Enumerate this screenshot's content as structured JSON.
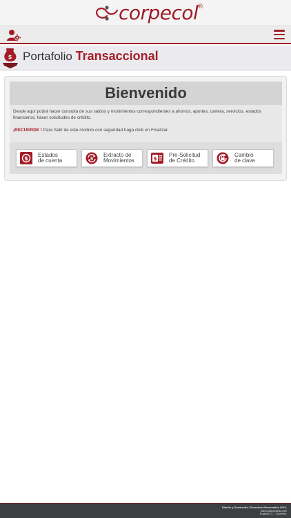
{
  "header": {
    "logo_text": "corpecol",
    "logo_reg": "®",
    "icons": {
      "logo": "corpecol-logo-icon",
      "user": "user-settings-icon",
      "menu": "menu-icon"
    }
  },
  "title": {
    "prefix": "Portafolio",
    "highlight": "Transaccional",
    "icon": "money-bag-icon"
  },
  "welcome": {
    "heading": "Bienvenido",
    "description": "Desde aquí podrá hacer consulta de sus saldos y movimientos correspondientes a ahorros, aportes, cartera, servicios, estados financieros, hacer solicitudes de crédito.",
    "recuerde_label": "¡RECUERDE !",
    "recuerde_text": " Para Salir de este modulo con seguridad haga click en Finalizar."
  },
  "buttons": [
    {
      "line1": "Estados",
      "line2": "de cuenta",
      "icon": "dollar-badge-icon"
    },
    {
      "line1": "Extracto de",
      "line2": "Movimientos",
      "icon": "dollar-refresh-icon"
    },
    {
      "line1": "Pre-Solicitud",
      "line2": "de Crédito",
      "icon": "credit-card-icon"
    },
    {
      "line1": "Cambio",
      "line2": "de clave",
      "icon": "lock-refresh-icon"
    }
  ],
  "footer": {
    "line1": "Diseño y Desarrollo / Derechos Reservados 2016.",
    "line2": "www.holacorpdesa.com",
    "line3": "Bogotá D.C. - Colombia."
  },
  "colors": {
    "brand": "#a31d27",
    "footer_bg": "#3c4043",
    "panel_head": "#d4d4d4"
  }
}
